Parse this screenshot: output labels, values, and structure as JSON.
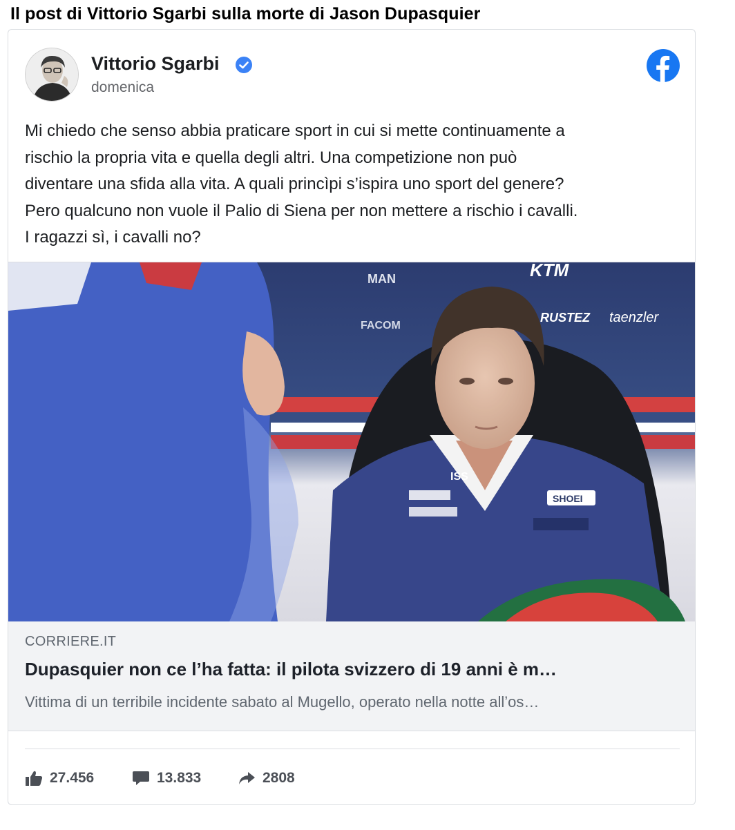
{
  "page": {
    "heading": "Il post di Vittorio Sgarbi sulla morte di Jason Dupasquier"
  },
  "post": {
    "author": "Vittorio Sgarbi",
    "date": "domenica",
    "verified": true,
    "platform_icon": "facebook-icon",
    "text_lines": [
      "Mi chiedo che senso abbia praticare sport in cui si mette continuamente a",
      "rischio la propria vita e quella degli altri. Una competizione non può",
      "diventare una sfida alla vita. A quali princìpi s’ispira uno sport del genere?",
      "Pero qualcuno non vuole il Palio di Siena per non mettere a rischio i cavalli.",
      "I ragazzi sì, i cavalli no?"
    ]
  },
  "link_preview": {
    "image_labels": [
      "MAN",
      "KTM",
      "FACOM",
      "RUSTEZ",
      "taenzler",
      "SHOEI",
      "ISS"
    ],
    "source": "CORRIERE.IT",
    "title": "Dupasquier non ce l’ha fatta: il pilota svizzero di 19 anni è m…",
    "description": "Vittima di un terribile incidente sabato al Mugello, operato nella notte all’os…"
  },
  "actions": {
    "likes": "27.456",
    "comments": "13.833",
    "shares": "2808"
  },
  "colors": {
    "facebook_blue": "#1877f2",
    "verified_blue": "#3b82f6",
    "muted_text": "#65676b",
    "preview_bg": "#f2f3f5"
  }
}
